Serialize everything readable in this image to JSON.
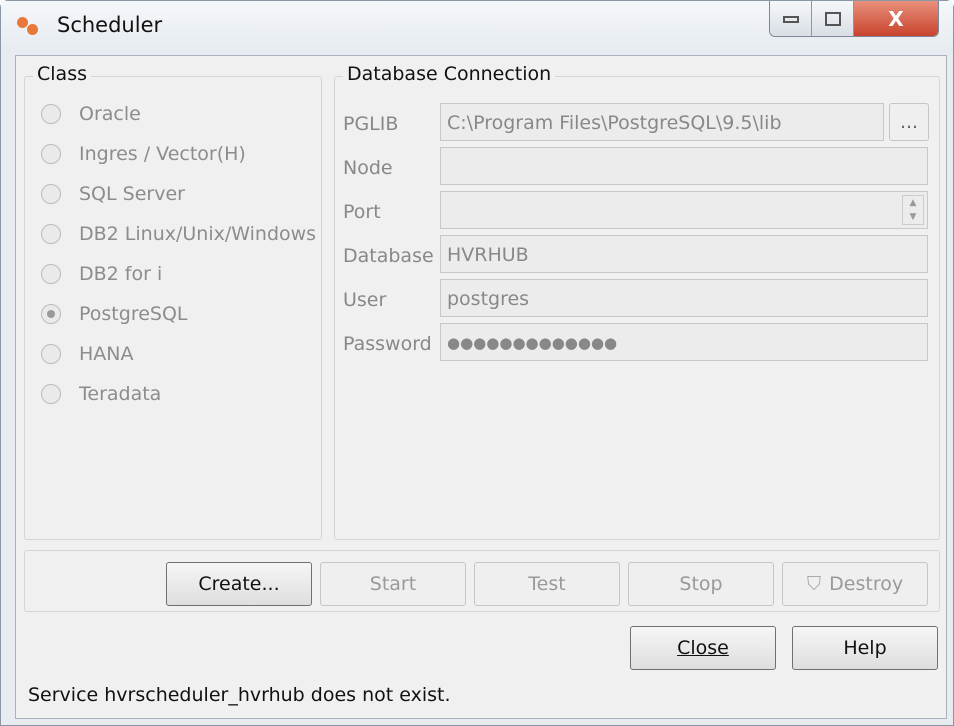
{
  "window": {
    "title": "Scheduler",
    "minimize_icon": "minimize-icon",
    "maximize_icon": "maximize-icon",
    "close_label": "X"
  },
  "class_group": {
    "label": "Class",
    "options": [
      {
        "label": "Oracle",
        "selected": false
      },
      {
        "label": "Ingres / Vector(H)",
        "selected": false
      },
      {
        "label": "SQL Server",
        "selected": false
      },
      {
        "label": "DB2 Linux/Unix/Windows",
        "selected": false
      },
      {
        "label": "DB2 for i",
        "selected": false
      },
      {
        "label": "PostgreSQL",
        "selected": true
      },
      {
        "label": "HANA",
        "selected": false
      },
      {
        "label": "Teradata",
        "selected": false
      }
    ]
  },
  "db_group": {
    "label": "Database Connection",
    "pglib": {
      "label": "PGLIB",
      "value": "C:\\Program Files\\PostgreSQL\\9.5\\lib",
      "browse": "..."
    },
    "node": {
      "label": "Node",
      "value": ""
    },
    "port": {
      "label": "Port",
      "value": ""
    },
    "database": {
      "label": "Database",
      "value": "HVRHUB"
    },
    "user": {
      "label": "User",
      "value": "postgres"
    },
    "password": {
      "label": "Password",
      "value": "●●●●●●●●●●●●●"
    }
  },
  "actions": {
    "create": "Create...",
    "start": "Start",
    "test": "Test",
    "stop": "Stop",
    "destroy": "Destroy"
  },
  "footer": {
    "close": "Close",
    "help": "Help"
  },
  "status": "Service hvrscheduler_hvrhub does not exist."
}
